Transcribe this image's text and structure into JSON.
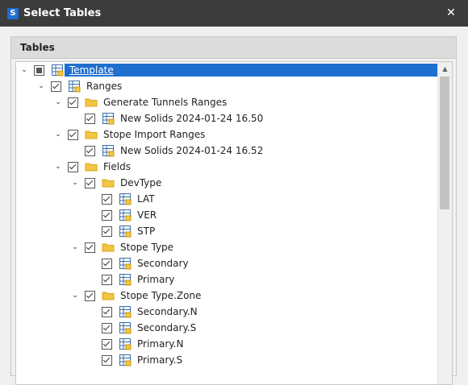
{
  "window": {
    "title": "Select Tables"
  },
  "group": {
    "header": "Tables"
  },
  "tree": [
    {
      "label": "Template",
      "level": 0,
      "expander": "expanded",
      "check": "partial",
      "icon": "table",
      "selected": true
    },
    {
      "label": "Ranges",
      "level": 1,
      "expander": "expanded",
      "check": "checked",
      "icon": "table"
    },
    {
      "label": "Generate Tunnels Ranges",
      "level": 2,
      "expander": "expanded",
      "check": "checked",
      "icon": "folder"
    },
    {
      "label": "New Solids 2024-01-24 16.50",
      "level": 3,
      "expander": "none",
      "check": "checked",
      "icon": "table"
    },
    {
      "label": "Stope Import Ranges",
      "level": 2,
      "expander": "expanded",
      "check": "checked",
      "icon": "folder"
    },
    {
      "label": "New Solids 2024-01-24 16.52",
      "level": 3,
      "expander": "none",
      "check": "checked",
      "icon": "table"
    },
    {
      "label": "Fields",
      "level": 2,
      "expander": "expanded",
      "check": "checked",
      "icon": "folder"
    },
    {
      "label": "DevType",
      "level": 3,
      "expander": "expanded",
      "check": "checked",
      "icon": "folder"
    },
    {
      "label": "LAT",
      "level": 4,
      "expander": "none",
      "check": "checked",
      "icon": "table"
    },
    {
      "label": "VER",
      "level": 4,
      "expander": "none",
      "check": "checked",
      "icon": "table"
    },
    {
      "label": "STP",
      "level": 4,
      "expander": "none",
      "check": "checked",
      "icon": "table"
    },
    {
      "label": "Stope Type",
      "level": 3,
      "expander": "expanded",
      "check": "checked",
      "icon": "folder"
    },
    {
      "label": "Secondary",
      "level": 4,
      "expander": "none",
      "check": "checked",
      "icon": "table"
    },
    {
      "label": "Primary",
      "level": 4,
      "expander": "none",
      "check": "checked",
      "icon": "table"
    },
    {
      "label": "Stope Type.Zone",
      "level": 3,
      "expander": "expanded",
      "check": "checked",
      "icon": "folder"
    },
    {
      "label": "Secondary.N",
      "level": 4,
      "expander": "none",
      "check": "checked",
      "icon": "table"
    },
    {
      "label": "Secondary.S",
      "level": 4,
      "expander": "none",
      "check": "checked",
      "icon": "table"
    },
    {
      "label": "Primary.N",
      "level": 4,
      "expander": "none",
      "check": "checked",
      "icon": "table"
    },
    {
      "label": "Primary.S",
      "level": 4,
      "expander": "none",
      "check": "checked",
      "icon": "table"
    }
  ],
  "colors": {
    "selection": "#1f6fd0",
    "titlebar": "#3c3c3c",
    "folder": "#f4c542"
  }
}
